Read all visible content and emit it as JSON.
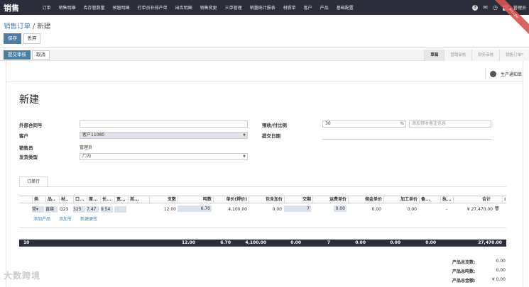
{
  "app": {
    "brand": "销售"
  },
  "menu": [
    "订单",
    "销售明细",
    "库存管数量",
    "预留明细",
    "打单员补排产单",
    "出库明细",
    "销售变更",
    "三单管理",
    "销量统计报表",
    "材质单",
    "客户",
    "产品",
    "基础配置"
  ],
  "topbar": {
    "user": "管理员",
    "ribbon": "Private"
  },
  "breadcrumb": {
    "parent": "销售订单",
    "sep": " / ",
    "current": "新建"
  },
  "buttons": {
    "save": "保存",
    "discard": "丢弃",
    "submit": "提交审核",
    "cancel": "取消"
  },
  "stages": [
    "草稿",
    "营销审核",
    "财务审核",
    "销售订单*"
  ],
  "smart": {
    "production_notice": "生产通知单"
  },
  "form": {
    "title": "新建",
    "ext_contract_label": "外部合同号",
    "ext_contract_value": "",
    "customer_label": "客户",
    "customer_value": "客户11080",
    "salesman_label": "销售员",
    "salesman_value": "管理员",
    "ship_type_label": "发货类型",
    "ship_type_value": "厂内",
    "prepay_label": "预收/付比例",
    "prepay_value": "30",
    "prepay_unit": "%",
    "prepay_note_placeholder": "添加预收备注信息",
    "submit_date_label": "提交日期"
  },
  "tabs": {
    "order_lines": "订单行"
  },
  "table": {
    "headers": [
      "类...",
      "品...",
      "材...",
      "口...",
      "厚...",
      "长...",
      "宽...",
      "其...",
      "支数",
      "吨数",
      "单价(焊价)",
      "包含加价",
      "交期",
      "运费单价",
      "佣金单价",
      "加工单价",
      "备...",
      "执...",
      "合计"
    ],
    "row": {
      "c1": "常",
      "c2": "直缝",
      "c3": "Q23",
      "c4": "325",
      "c5": "7.47",
      "c6": "9.54",
      "c7": "",
      "c8": "",
      "qty": "12.00",
      "tons": "6.70",
      "price": "4,100.00",
      "markup": "0.00",
      "lead": "7",
      "freight": "0.00",
      "commission": "0.00",
      "processing": "0.00",
      "note": "",
      "exec": "-",
      "total": "¥ 27,470.00"
    },
    "links": {
      "add_product": "添加产品",
      "add_section": "添加节",
      "add_note": "新建便签"
    },
    "totals": {
      "count": "10",
      "qty": "12.00",
      "tons": "6.70",
      "price": "4,100.00",
      "markup": "0.00",
      "lead": "7",
      "freight": "0.00",
      "commission": "0.00",
      "processing": "0.00",
      "total": "27,470.00"
    }
  },
  "summary": {
    "qty_label": "产品总支数:",
    "qty_value": "0.00",
    "tons_label": "产品总吨数:",
    "tons_value": "0.00",
    "amount_label": "产品总金额:",
    "amount_value": "¥ 0.00"
  },
  "watermark": "大数跨境"
}
